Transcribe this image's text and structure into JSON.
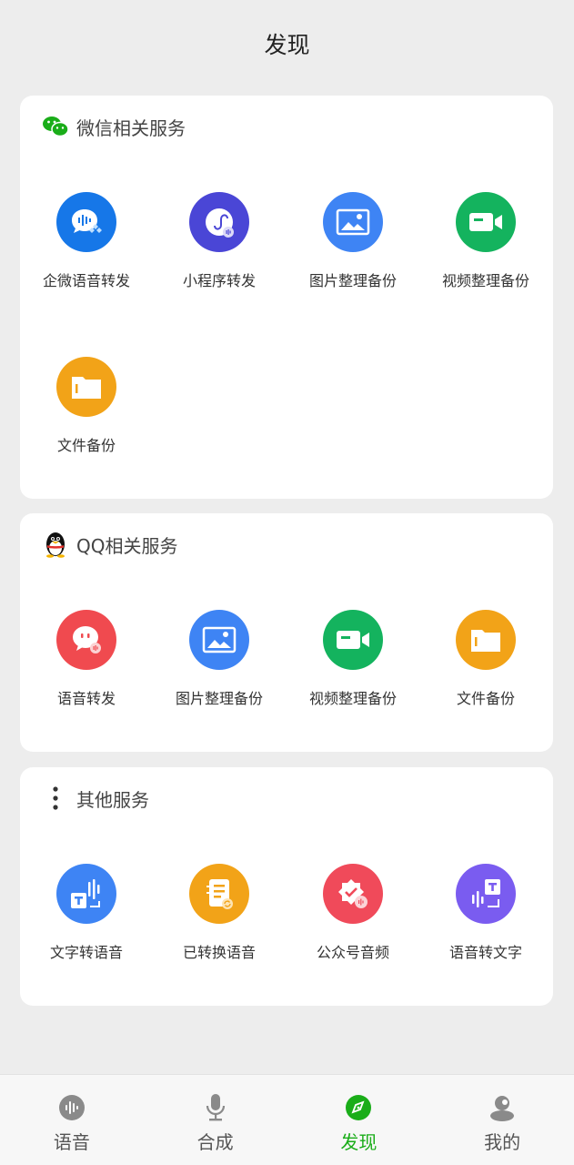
{
  "header": {
    "title": "发现"
  },
  "sections": [
    {
      "title": "微信相关服务",
      "icon": "wechat-icon",
      "items": [
        {
          "label": "企微语音转发",
          "icon": "wecom-voice-icon",
          "color": "#1677e8"
        },
        {
          "label": "小程序转发",
          "icon": "mini-program-icon",
          "color": "#4a46d6"
        },
        {
          "label": "图片整理备份",
          "icon": "image-icon",
          "color": "#3e84f4"
        },
        {
          "label": "视频整理备份",
          "icon": "video-icon",
          "color": "#14b35e"
        },
        {
          "label": "文件备份",
          "icon": "folder-icon",
          "color": "#f2a318"
        }
      ]
    },
    {
      "title": "QQ相关服务",
      "icon": "qq-penguin-icon",
      "items": [
        {
          "label": "语音转发",
          "icon": "chat-voice-icon",
          "color": "#f04a4f"
        },
        {
          "label": "图片整理备份",
          "icon": "image-icon",
          "color": "#3e84f4"
        },
        {
          "label": "视频整理备份",
          "icon": "video-icon",
          "color": "#14b35e"
        },
        {
          "label": "文件备份",
          "icon": "folder-icon",
          "color": "#f2a318"
        }
      ]
    },
    {
      "title": "其他服务",
      "icon": "more-dots-icon",
      "items": [
        {
          "label": "文字转语音",
          "icon": "text-to-speech-icon",
          "color": "#3e84f4"
        },
        {
          "label": "已转换语音",
          "icon": "converted-voice-icon",
          "color": "#f2a318"
        },
        {
          "label": "公众号音频",
          "icon": "official-account-audio-icon",
          "color": "#f04a5a"
        },
        {
          "label": "语音转文字",
          "icon": "speech-to-text-icon",
          "color": "#7a5cf0"
        }
      ]
    }
  ],
  "tabbar": {
    "items": [
      {
        "label": "语音",
        "icon": "voice-wave-icon"
      },
      {
        "label": "合成",
        "icon": "microphone-icon"
      },
      {
        "label": "发现",
        "icon": "compass-icon",
        "active": true
      },
      {
        "label": "我的",
        "icon": "profile-icon"
      }
    ],
    "active_color": "#1aad19",
    "inactive_color": "#8a8a8a"
  }
}
